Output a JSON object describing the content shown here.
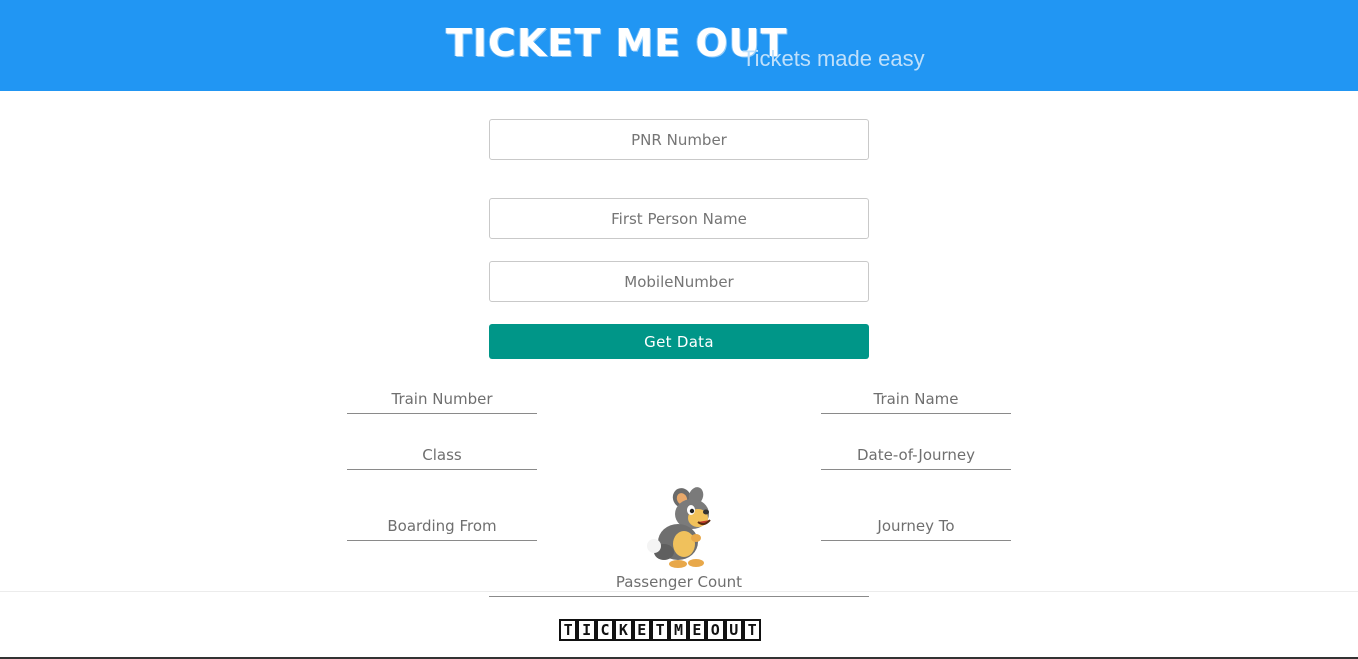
{
  "header": {
    "title": "TICKET ME OUT",
    "tagline": "Tickets made easy",
    "background_color": "#2196f3"
  },
  "form": {
    "pnr_placeholder": "PNR Number",
    "first_person_placeholder": "First Person Name",
    "mobile_placeholder": "MobileNumber",
    "get_data_label": "Get Data",
    "button_color": "#009688"
  },
  "details": {
    "train_number_placeholder": "Train Number",
    "train_name_placeholder": "Train Name",
    "class_placeholder": "Class",
    "doj_placeholder": "Date-of-Journey",
    "boarding_placeholder": "Boarding From",
    "journey_to_placeholder": "Journey To",
    "passenger_count_placeholder": "Passenger Count"
  },
  "mascot": {
    "icon": "rabbit-mascot-icon"
  },
  "footer": {
    "logo_letters": [
      "T",
      "I",
      "C",
      "K",
      "E",
      "T",
      "M",
      "E",
      "O",
      "U",
      "T"
    ]
  }
}
